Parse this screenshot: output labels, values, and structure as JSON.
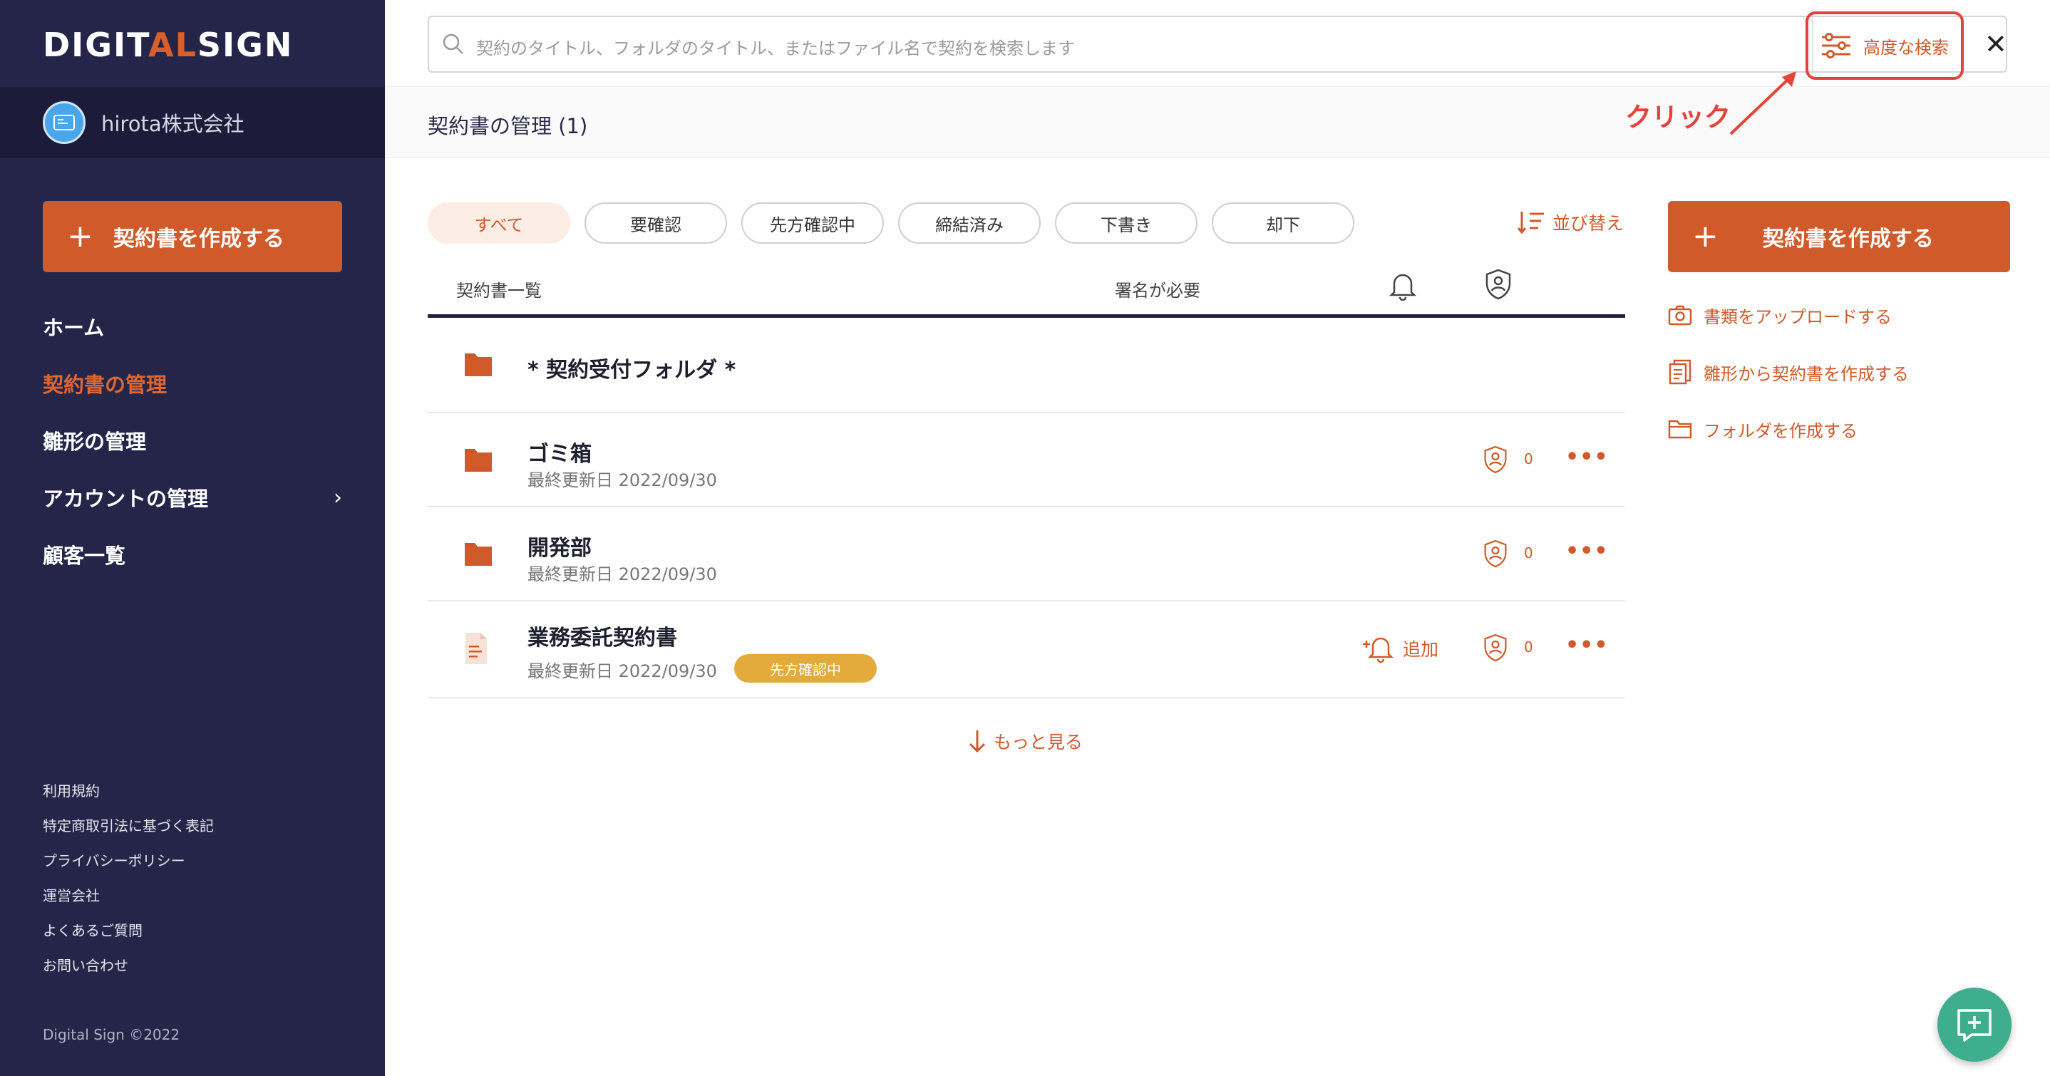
{
  "sidebar": {
    "logo_a": "DIGIT",
    "logo_b": "AL",
    "logo_c": "SIGN",
    "company_name": "hirota株式会社",
    "create_label": "契約書を作成する",
    "nav": [
      {
        "label": "ホーム",
        "active": false
      },
      {
        "label": "契約書の管理",
        "active": true
      },
      {
        "label": "雛形の管理",
        "active": false
      },
      {
        "label": "アカウントの管理",
        "active": false,
        "chevron": true
      },
      {
        "label": "顧客一覧",
        "active": false
      }
    ],
    "footer_links": [
      "利用規約",
      "特定商取引法に基づく表記",
      "プライバシーポリシー",
      "運営会社",
      "よくあるご質問",
      "お問い合わせ"
    ],
    "copyright": "Digital Sign ©2022"
  },
  "topbar": {
    "search_placeholder": "契約のタイトル、フォルダのタイトル、またはファイル名で契約を検索します",
    "advanced_search_label": "高度な検索",
    "close_symbol": "✕"
  },
  "breadcrumb": "契約書の管理 (1)",
  "annotation": "クリック",
  "filters": {
    "tabs": [
      "すべて",
      "要確認",
      "先方確認中",
      "締結済み",
      "下書き",
      "却下"
    ],
    "active_index": 0,
    "sort_label": "並び替え"
  },
  "table": {
    "header_list": "契約書一覧",
    "header_sign": "署名が必要",
    "rows": [
      {
        "type": "folder",
        "title": "* 契約受付フォルダ *"
      },
      {
        "type": "folder",
        "title": "ゴミ箱",
        "date": "最終更新日 2022/09/30",
        "count": "0"
      },
      {
        "type": "folder",
        "title": "開発部",
        "date": "最終更新日 2022/09/30",
        "count": "0"
      },
      {
        "type": "document",
        "title": "業務委託契約書",
        "date": "最終更新日 2022/09/30",
        "badge": "先方確認中",
        "add_label": "追加",
        "count": "0"
      }
    ],
    "more_label": "もっと見る"
  },
  "right_panel": {
    "create_label": "契約書を作成する",
    "links": [
      "書類をアップロードする",
      "雛形から契約書を作成する",
      "フォルダを作成する"
    ]
  },
  "colors": {
    "sidebar": "#25254a",
    "accent": "#d05a2a",
    "annotation": "#e5423a",
    "badge": "#e3ab3b",
    "fab": "#3fae8e"
  }
}
